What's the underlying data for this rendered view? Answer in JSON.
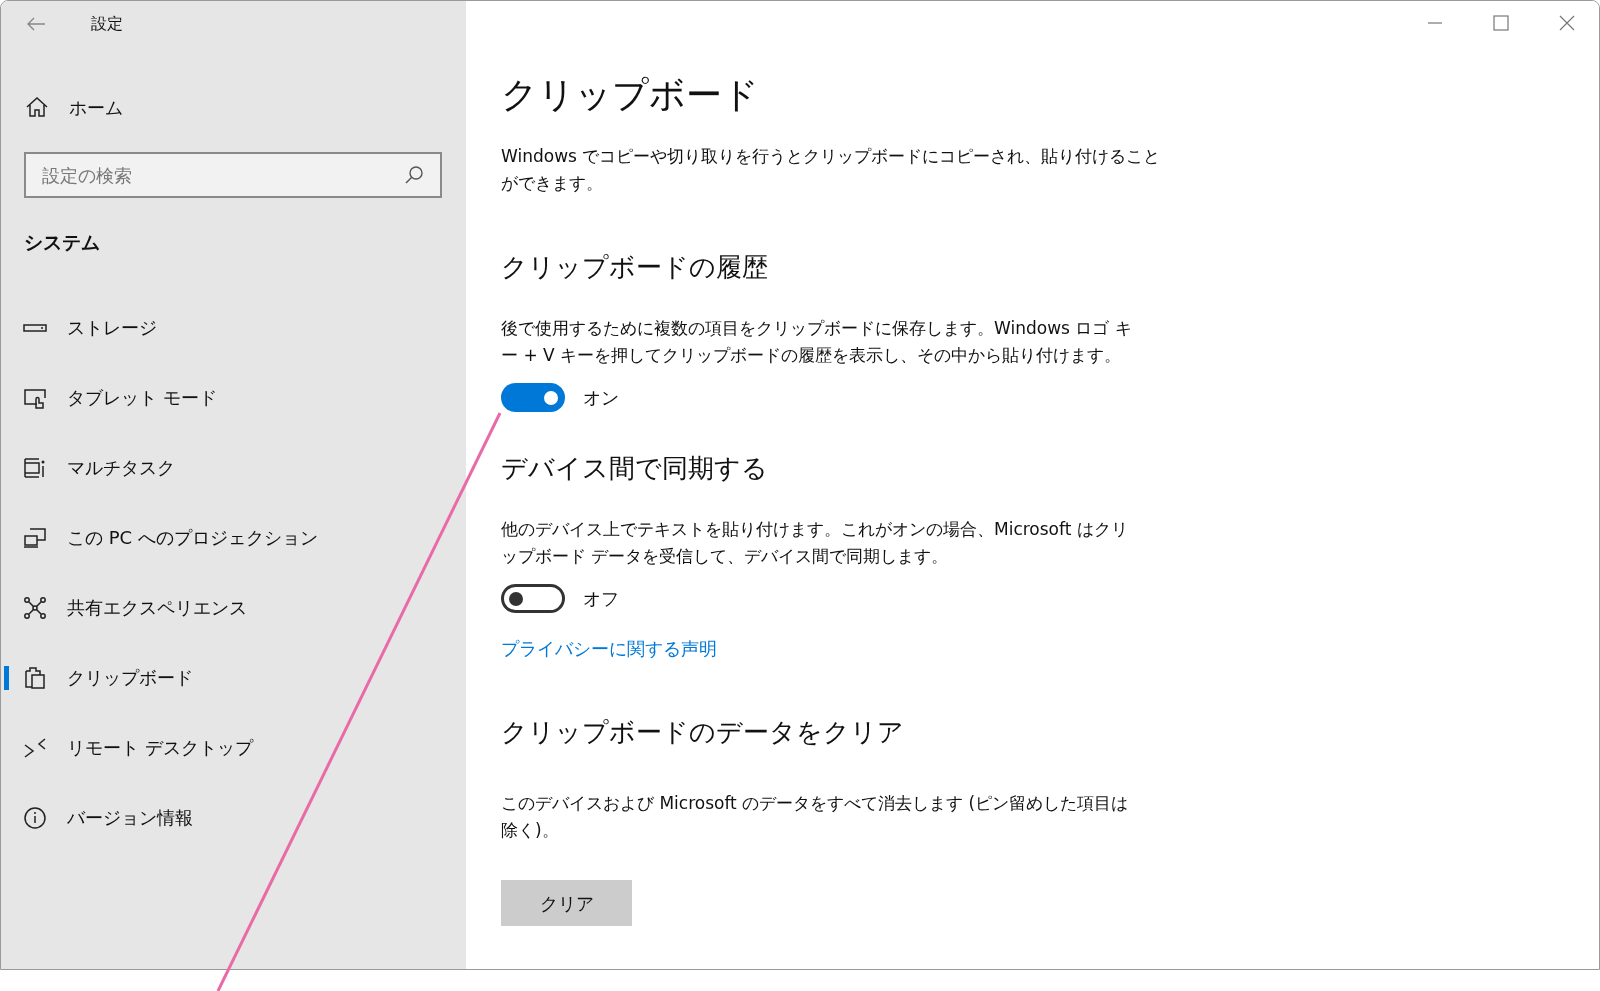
{
  "window": {
    "title": "設定"
  },
  "sidebar": {
    "home": "ホーム",
    "search": {
      "placeholder": "設定の検索"
    },
    "section": "システム",
    "items": [
      {
        "label": "ストレージ",
        "kind": "storage",
        "selected": false
      },
      {
        "label": "タブレット モード",
        "kind": "tablet",
        "selected": false
      },
      {
        "label": "マルチタスク",
        "kind": "multitask",
        "selected": false
      },
      {
        "label": "この PC へのプロジェクション",
        "kind": "projection",
        "selected": false
      },
      {
        "label": "共有エクスペリエンス",
        "kind": "shared",
        "selected": false
      },
      {
        "label": "クリップボード",
        "kind": "clipboard",
        "selected": true
      },
      {
        "label": "リモート デスクトップ",
        "kind": "remote",
        "selected": false
      },
      {
        "label": "バージョン情報",
        "kind": "info",
        "selected": false
      }
    ]
  },
  "content": {
    "title": "クリップボード",
    "intro": "Windows でコピーや切り取りを行うとクリップボードにコピーされ、貼り付けることができます。",
    "sections": [
      {
        "heading": "クリップボードの履歴",
        "description": "後で使用するために複数の項目をクリップボードに保存します。Windows ロゴ キー + V キーを押してクリップボードの履歴を表示し、その中から貼り付けます。",
        "toggle": {
          "on": true,
          "label": "オン"
        }
      },
      {
        "heading": "デバイス間で同期する",
        "description": "他のデバイス上でテキストを貼り付けます。これがオンの場合、Microsoft はクリップボード データを受信して、デバイス間で同期します。",
        "toggle": {
          "on": false,
          "label": "オフ"
        },
        "link": "プライバシーに関する声明"
      },
      {
        "heading": "クリップボードのデータをクリア",
        "description": "このデバイスおよび Microsoft のデータをすべて消去します (ピン留めした項目は除く)。",
        "button": "クリア"
      }
    ]
  }
}
